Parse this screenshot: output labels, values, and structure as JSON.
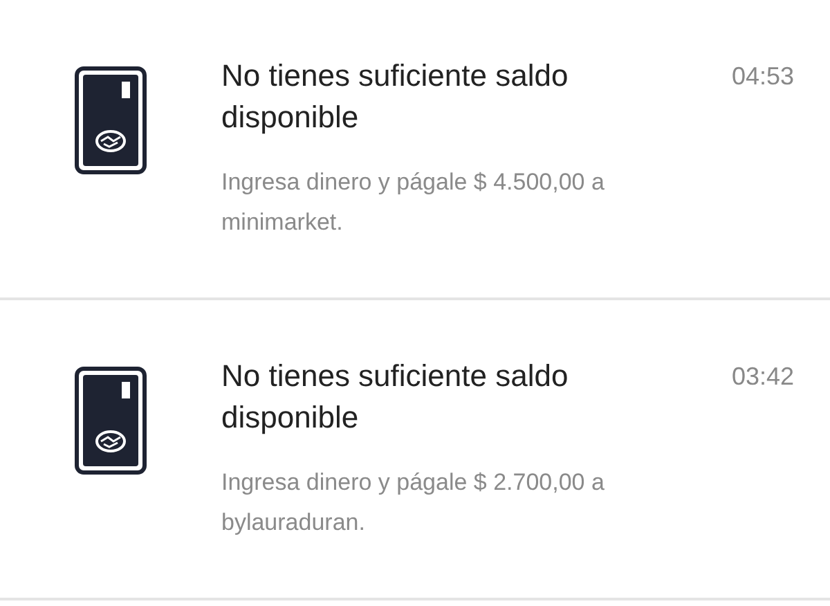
{
  "notifications": [
    {
      "title": "No tienes suficiente saldo disponible",
      "time": "04:53",
      "body": "Ingresa dinero y págale $ 4.500,00 a minimarket."
    },
    {
      "title": "No tienes suficiente saldo disponible",
      "time": "03:42",
      "body": "Ingresa dinero y págale $ 2.700,00 a bylauraduran."
    }
  ]
}
